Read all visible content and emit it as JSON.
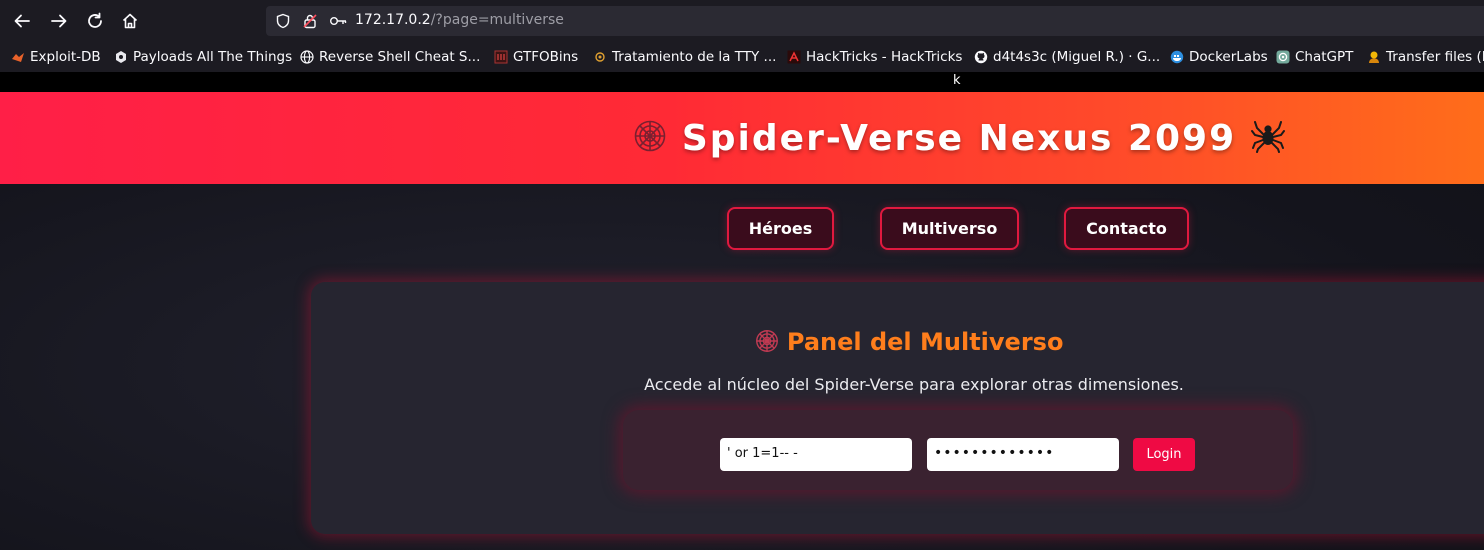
{
  "browser": {
    "url_host": "172.17.0.2",
    "url_rest": "/?page=multiverse",
    "tooltip": "k",
    "bookmarks": [
      {
        "label": "Exploit-DB",
        "icon": "exploit-db-icon"
      },
      {
        "label": "Payloads All The Things",
        "icon": "payloads-icon"
      },
      {
        "label": "Reverse Shell Cheat S...",
        "icon": "globe-icon"
      },
      {
        "label": "GTFOBins",
        "icon": "gtfobins-icon"
      },
      {
        "label": "Tratamiento de la TTY ...",
        "icon": "tty-icon"
      },
      {
        "label": "HackTricks - HackTricks",
        "icon": "hacktricks-icon"
      },
      {
        "label": "d4t4s3c (Miguel R.) · G...",
        "icon": "github-icon"
      },
      {
        "label": "DockerLabs",
        "icon": "dockerlabs-icon"
      },
      {
        "label": "ChatGPT",
        "icon": "chatgpt-icon"
      },
      {
        "label": "Transfer files (P",
        "icon": "transfer-icon"
      }
    ]
  },
  "header": {
    "title": "Spider-Verse Nexus 2099"
  },
  "nav": {
    "heroes": "Héroes",
    "multiverse": "Multiverso",
    "contact": "Contacto"
  },
  "panel": {
    "title": "Panel del Multiverso",
    "subtitle": "Accede al núcleo del Spider-Verse para explorar otras dimensiones.",
    "username_value": "' or 1=1-- -",
    "password_value": "•••••••••••••",
    "login_label": "Login"
  },
  "colors": {
    "accent": "#ef0a44",
    "title_orange": "#ff7e1c",
    "header_start": "#ff1f47",
    "header_end": "#ff6d1a"
  }
}
